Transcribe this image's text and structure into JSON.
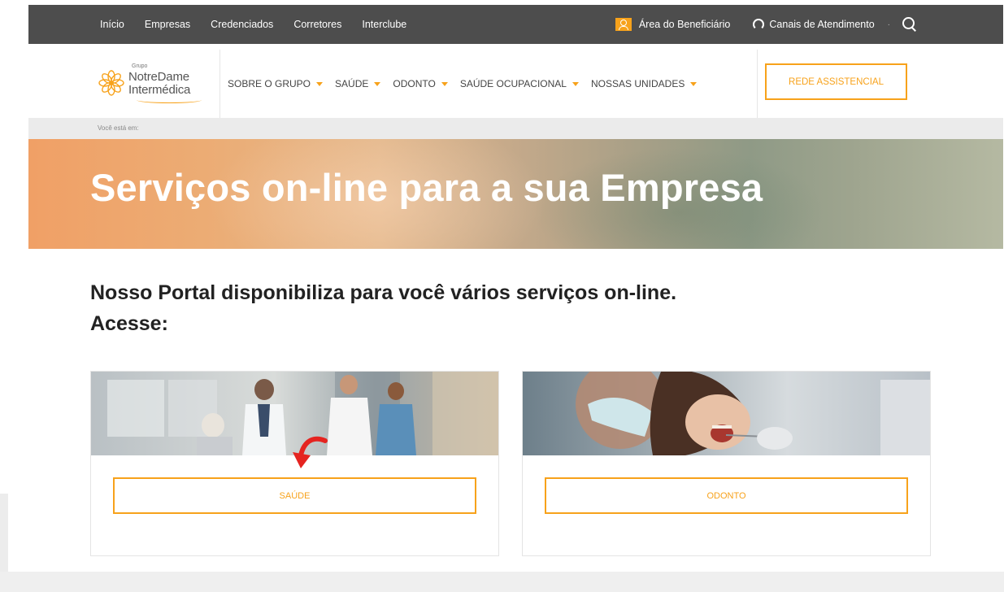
{
  "topbar": {
    "nav": [
      "Início",
      "Empresas",
      "Credenciados",
      "Corretores",
      "Interclube"
    ],
    "beneficiario_label": "Área do Beneficiário",
    "canais_label": "Canais de Atendimento",
    "dot": "·"
  },
  "logo": {
    "grupo": "Grupo",
    "line1": "NotreDame",
    "line2": "Intermédica"
  },
  "mainnav": [
    "SOBRE O GRUPO",
    "SAÚDE",
    "ODONTO",
    "SAÚDE OCUPACIONAL",
    "NOSSAS UNIDADES"
  ],
  "rede_button": "REDE ASSISTENCIAL",
  "breadcrumb": "Você está em:",
  "hero_title": "Serviços on-line para a sua Empresa",
  "intro": {
    "line1": "Nosso Portal disponibiliza para você vários serviços on-line.",
    "line2": "Acesse:"
  },
  "cards": [
    {
      "button": "SAÚDE"
    },
    {
      "button": "ODONTO"
    }
  ],
  "colors": {
    "accent": "#f7a21b",
    "topbar": "#4d4d4d",
    "annotation_arrow": "#e52420"
  }
}
